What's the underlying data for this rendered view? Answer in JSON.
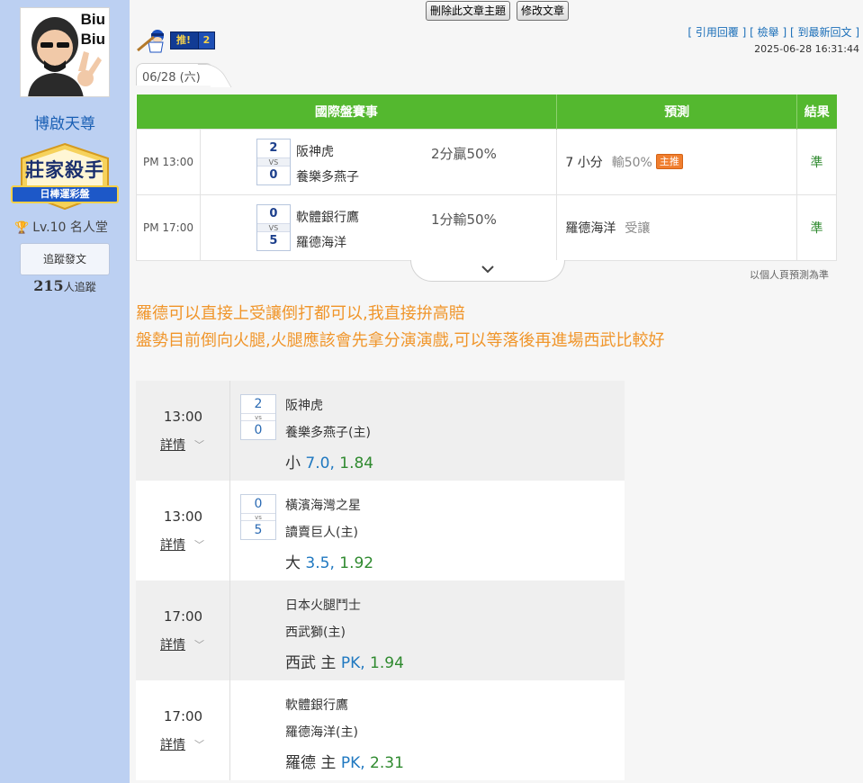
{
  "sidebar": {
    "avatar_text": "Biu\nBiu",
    "username": "博啟天尊",
    "badge_title": "莊家殺手",
    "badge_subtitle": "日棒運彩盤",
    "level": "Lv.10 名人堂",
    "follow_button": "追蹤發文",
    "followers_count": "215",
    "followers_label": "人追蹤"
  },
  "toolbar": {
    "delete_topic": "刪除此文章主題",
    "edit_post": "修改文章"
  },
  "push": {
    "label": "推!",
    "count": "2"
  },
  "post_links": {
    "quote_reply": "引用回覆",
    "report": "檢舉",
    "latest_reply": "到最新回文",
    "timestamp": "2025-06-28 16:31:44"
  },
  "date_tab": "06/28 (六)",
  "prediction_table": {
    "headers": {
      "game": "國際盤賽事",
      "prediction": "預測",
      "result": "結果"
    },
    "rows": [
      {
        "time": "PM 13:00",
        "score1": "2",
        "vs": "VS",
        "score2": "0",
        "team1": "阪神虎",
        "team2": "養樂多燕子",
        "game_result": "2分贏50%",
        "prediction": "7 小分",
        "outcome": "輸50%",
        "tag": "主推",
        "result": "準"
      },
      {
        "time": "PM 17:00",
        "score1": "0",
        "vs": "VS",
        "score2": "5",
        "team1": "軟體銀行鷹",
        "team2": "羅德海洋",
        "game_result": "1分輸50%",
        "prediction": "羅德海洋",
        "outcome": "受讓",
        "tag": "",
        "result": "準"
      }
    ]
  },
  "basis_note": "以個人頁預測為準",
  "analysis": [
    "羅德可以直接上受讓倒打都可以,我直接拚高賠",
    "盤勢目前倒向火腿,火腿應該會先拿分演演戲,可以等落後再進場西武比較好"
  ],
  "games": [
    {
      "time": "13:00",
      "detail": "詳情",
      "score1": "2",
      "vs": "vs",
      "score2": "0",
      "team1": "阪神虎",
      "team2": "養樂多燕子(主)",
      "pick": "小",
      "line": "7.0,",
      "odds": "1.84"
    },
    {
      "time": "13:00",
      "detail": "詳情",
      "score1": "0",
      "vs": "vs",
      "score2": "5",
      "team1": "橫濱海灣之星",
      "team2": "讀賣巨人(主)",
      "pick": "大",
      "line": "3.5,",
      "odds": "1.92"
    },
    {
      "time": "17:00",
      "detail": "詳情",
      "score1": "",
      "vs": "",
      "score2": "",
      "team1": "日本火腿鬥士",
      "team2": "西武獅(主)",
      "pick": "西武 主",
      "line": "PK,",
      "odds": "1.94"
    },
    {
      "time": "17:00",
      "detail": "詳情",
      "score1": "",
      "vs": "",
      "score2": "",
      "team1": "軟體銀行鷹",
      "team2": "羅德海洋(主)",
      "pick": "羅德 主",
      "line": "PK,",
      "odds": "2.31"
    }
  ],
  "colors": {
    "sidebar": "#bcd0f2",
    "header_green": "#54b82f",
    "analysis_orange": "#f0952a",
    "odds_blue": "#1f78c0",
    "odds_green": "#2f8a2f"
  }
}
